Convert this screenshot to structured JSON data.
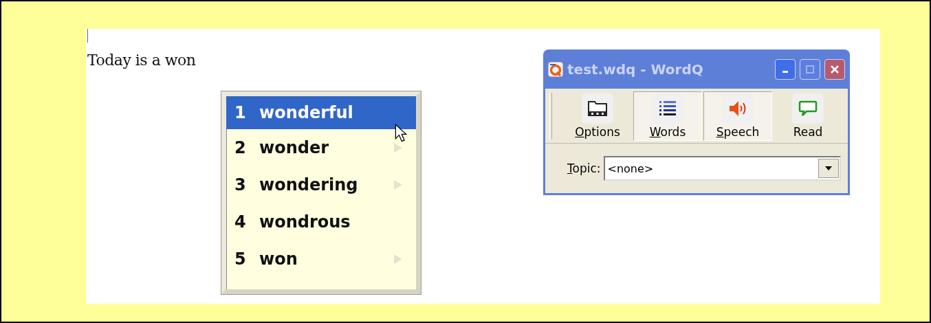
{
  "document": {
    "text": "Today is a won"
  },
  "suggestions": [
    {
      "number": "1",
      "word": "wonderful",
      "selected": true,
      "has_more": false
    },
    {
      "number": "2",
      "word": "wonder",
      "selected": false,
      "has_more": true
    },
    {
      "number": "3",
      "word": "wondering",
      "selected": false,
      "has_more": true
    },
    {
      "number": "4",
      "word": "wondrous",
      "selected": false,
      "has_more": false
    },
    {
      "number": "5",
      "word": "won",
      "selected": false,
      "has_more": true
    }
  ],
  "window": {
    "title": "test.wdq - WordQ",
    "toolbar": [
      {
        "kind": "options",
        "label": "Options",
        "pressed": false,
        "underline_first": true
      },
      {
        "kind": "words",
        "label": "Words",
        "pressed": true,
        "underline_first": true
      },
      {
        "kind": "speech",
        "label": "Speech",
        "pressed": true,
        "underline_first": true
      },
      {
        "kind": "read",
        "label": "Read",
        "pressed": false,
        "underline_first": false
      }
    ],
    "topic": {
      "label": "Topic:",
      "underline_first": true,
      "value": "<none>"
    }
  }
}
